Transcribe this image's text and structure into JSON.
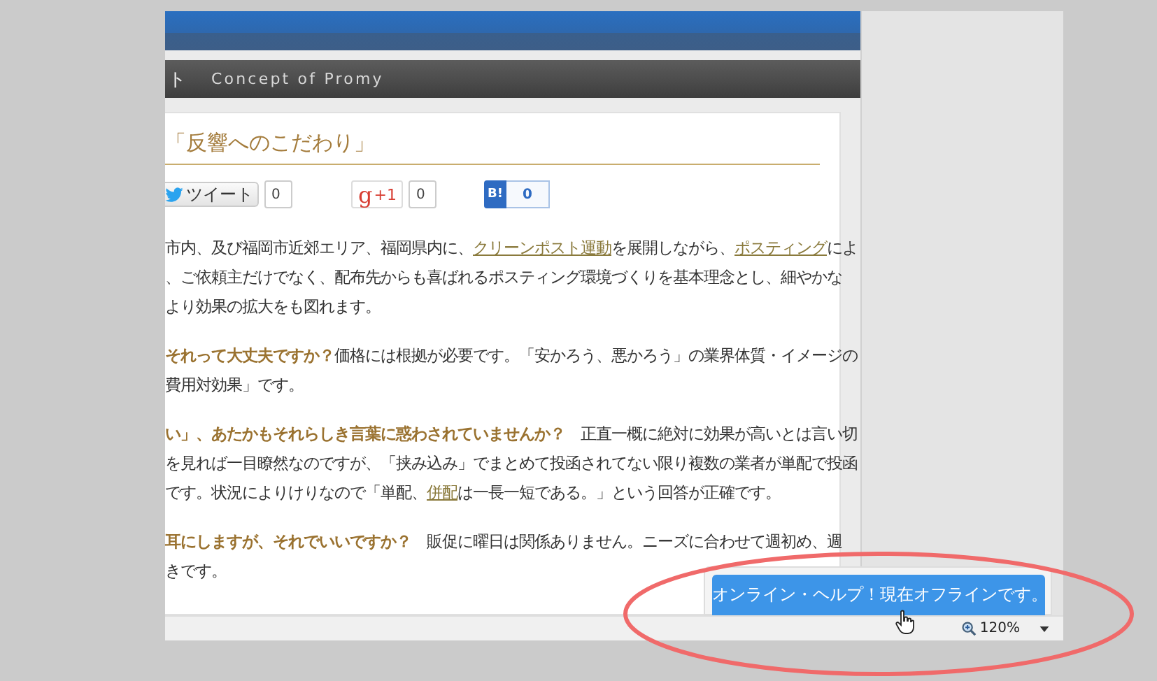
{
  "nav_bar": {
    "label_cut": "ト",
    "label": "Concept of Promy"
  },
  "heading": "「反響へのこだわり」",
  "share_buttons": [
    {
      "kind": "twitter",
      "label": "ツイート",
      "count": "0"
    },
    {
      "kind": "google",
      "glyph": "g",
      "label": "+1",
      "count": "0"
    },
    {
      "kind": "hatena",
      "label": "B!",
      "count": "0"
    }
  ],
  "paragraphs": [
    [
      [
        {
          "kind": "plain",
          "text": "市内、及び福岡市近郊エリア、福岡県内に、"
        },
        {
          "kind": "link",
          "text": "クリーンポスト運動"
        },
        {
          "kind": "plain",
          "text": "を展開しながら、"
        },
        {
          "kind": "link",
          "text": "ポスティング"
        },
        {
          "kind": "plain",
          "text": "によ"
        }
      ],
      [
        {
          "kind": "plain",
          "text": "、ご依頼主だけでなく、配布先からも喜ばれるポスティング環境づくりを基本理念とし、細やかな"
        }
      ],
      [
        {
          "kind": "plain",
          "text": "より効果の拡大をも図れます。"
        }
      ]
    ],
    [
      [
        {
          "kind": "strong",
          "text": "それって大丈夫ですか？"
        },
        {
          "kind": "plain",
          "text": "価格には根拠が必要です。「安かろう、悪かろう」の業界体質・イメージの"
        }
      ],
      [
        {
          "kind": "plain",
          "text": "費用対効果」です。"
        }
      ]
    ],
    [
      [
        {
          "kind": "strong",
          "text": "い」、あたかもそれらしき言葉に惑わされていませんか？"
        },
        {
          "kind": "plain",
          "text": "　正直一概に絶対に効果が高いとは言い切"
        }
      ],
      [
        {
          "kind": "plain",
          "text": "を見れば一目瞭然なのですが、「挟み込み」でまとめて投函されてない限り複数の業者が単配で投函"
        }
      ],
      [
        {
          "kind": "plain",
          "text": "です。状況によりけりなので「単配、"
        },
        {
          "kind": "link",
          "text": "併配"
        },
        {
          "kind": "plain",
          "text": "は一長一短である。」という回答が正確です。"
        }
      ]
    ],
    [
      [
        {
          "kind": "strong",
          "text": "耳にしますが、それでいいですか？"
        },
        {
          "kind": "plain",
          "text": "　販促に曜日は関係ありません。ニーズに合わせて週初め、週"
        }
      ],
      [
        {
          "kind": "plain",
          "text": "きです。"
        }
      ]
    ]
  ],
  "chat_button": "オンライン・ヘルプ！現在オフラインです。",
  "status_bar": {
    "zoom": "120%"
  }
}
